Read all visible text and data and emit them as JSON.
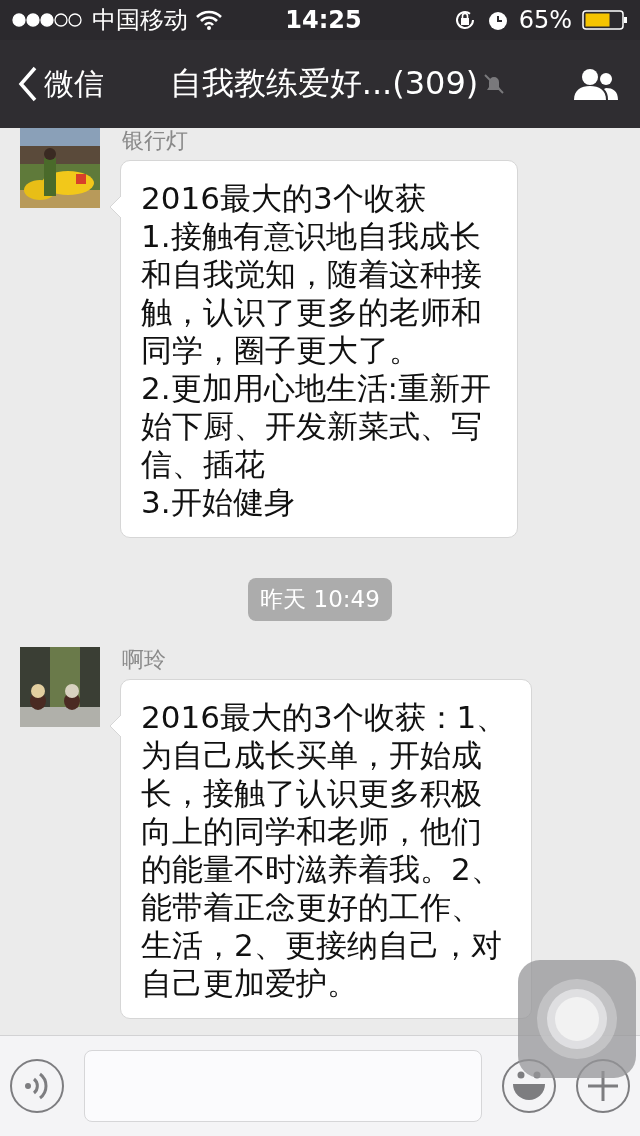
{
  "status_bar": {
    "carrier": "中国移动",
    "time": "14:25",
    "battery": "65%"
  },
  "nav": {
    "back": "微信",
    "title": "自我教练爱好...(309)",
    "muted": true
  },
  "messages": [
    {
      "kind": "message",
      "sender": "银行灯",
      "text": "2016最大的3个收获\n1.接触有意识地自我成长和自我觉知，随着这种接触，认识了更多的老师和同学，圈子更大了。\n2.更加用心地生活:重新开始下厨、开发新菜式、写信、插花\n3.开始健身"
    },
    {
      "kind": "timestamp",
      "text": "昨天 10:49"
    },
    {
      "kind": "message",
      "sender": "啊玲",
      "text": "2016最大的3个收获：1、为自己成长买单，开始成长，接触了认识更多积极向上的同学和老师，他们的能量不时滋养着我。2、能带着正念更好的工作、生活，2、更接纳自己，对自己更加爱护。"
    }
  ]
}
